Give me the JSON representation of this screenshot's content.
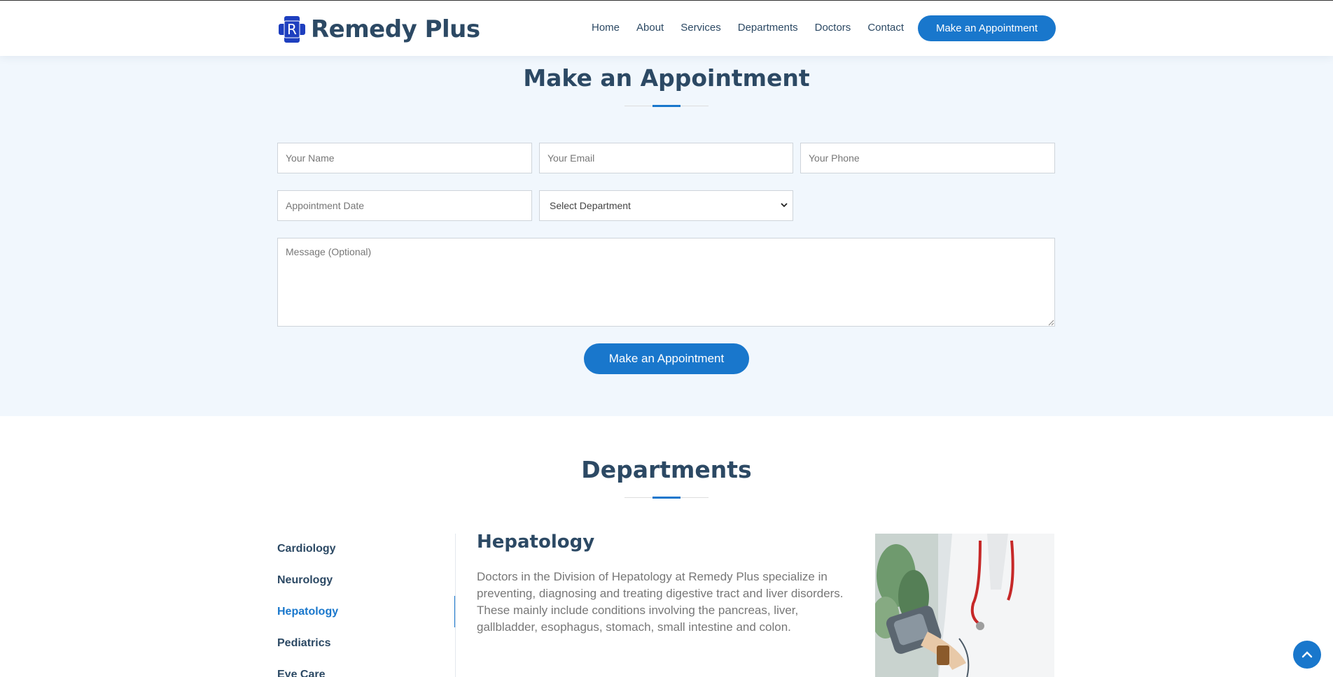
{
  "header": {
    "logo_letter": "R",
    "logo_text": "Remedy Plus",
    "nav": [
      "Home",
      "About",
      "Services",
      "Departments",
      "Doctors",
      "Contact"
    ],
    "cta_label": "Make an Appointment"
  },
  "appointment": {
    "title": "Make an Appointment",
    "name_placeholder": "Your Name",
    "email_placeholder": "Your Email",
    "phone_placeholder": "Your Phone",
    "date_placeholder": "Appointment Date",
    "department_selected": "Select Department",
    "message_placeholder": "Message (Optional)",
    "submit_label": "Make an Appointment"
  },
  "departments": {
    "title": "Departments",
    "tabs": [
      "Cardiology",
      "Neurology",
      "Hepatology",
      "Pediatrics",
      "Eye Care"
    ],
    "active_tab": "Hepatology",
    "detail_title": "Hepatology",
    "detail_text": "Doctors in the Division of Hepatology at Remedy Plus specialize in preventing, diagnosing and treating digestive tract and liver disorders. These mainly include conditions involving the pancreas, liver, gallbladder, esophagus, stomach, small intestine and colon."
  },
  "colors": {
    "accent": "#1977cc",
    "heading": "#2c4964",
    "section_bg": "#f1f7fd"
  },
  "icons": {
    "logo": "medical-cross-icon",
    "back_to_top": "chevron-up-icon"
  }
}
